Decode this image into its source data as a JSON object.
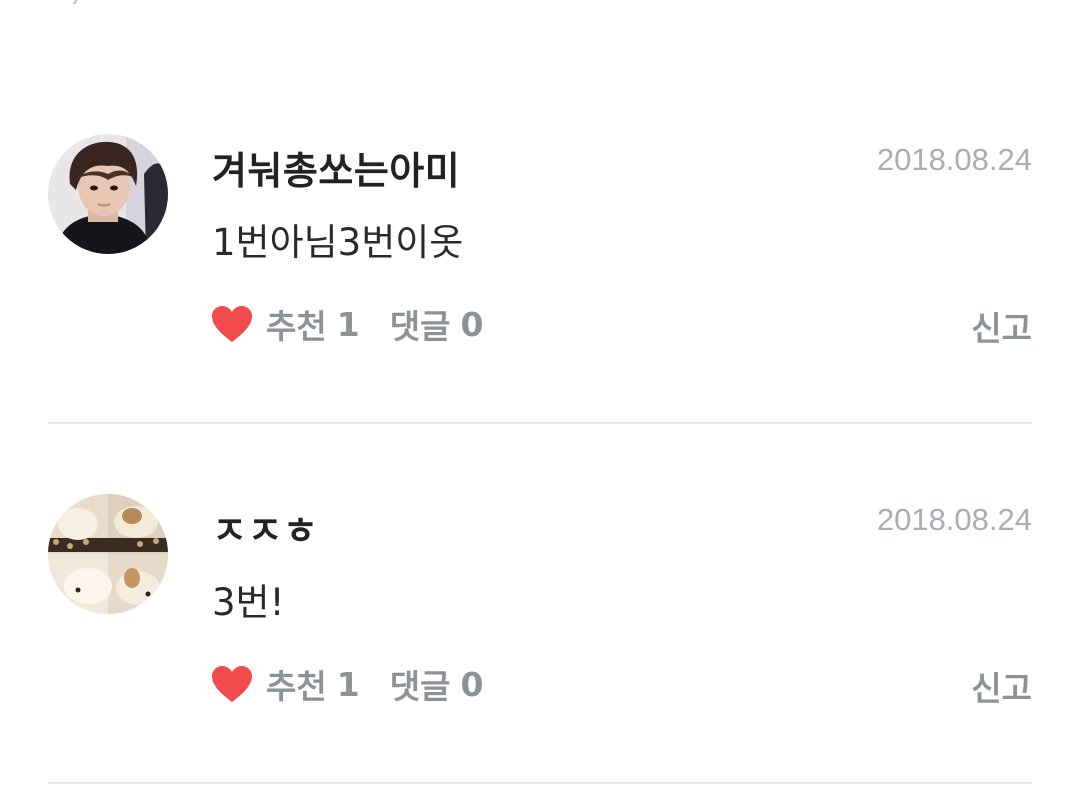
{
  "comments": [
    {
      "author": "겨눠총쏘는아미",
      "date": "2018.08.24",
      "text": "1번아님3번이옷",
      "like_label": "추천",
      "like_count": "1",
      "reply_label": "댓글",
      "reply_count": "0",
      "report_label": "신고",
      "avatar_icon": "profile-photo-person"
    },
    {
      "author": "ㅈㅈㅎ",
      "date": "2018.08.24",
      "text": "3번!",
      "like_label": "추천",
      "like_count": "1",
      "reply_label": "댓글",
      "reply_count": "0",
      "report_label": "신고",
      "avatar_icon": "profile-photo-puppy"
    }
  ],
  "colors": {
    "heart": "#f24b4b",
    "meta": "#8d9297",
    "date": "#a8adb3",
    "divider": "#e8e8e8"
  }
}
